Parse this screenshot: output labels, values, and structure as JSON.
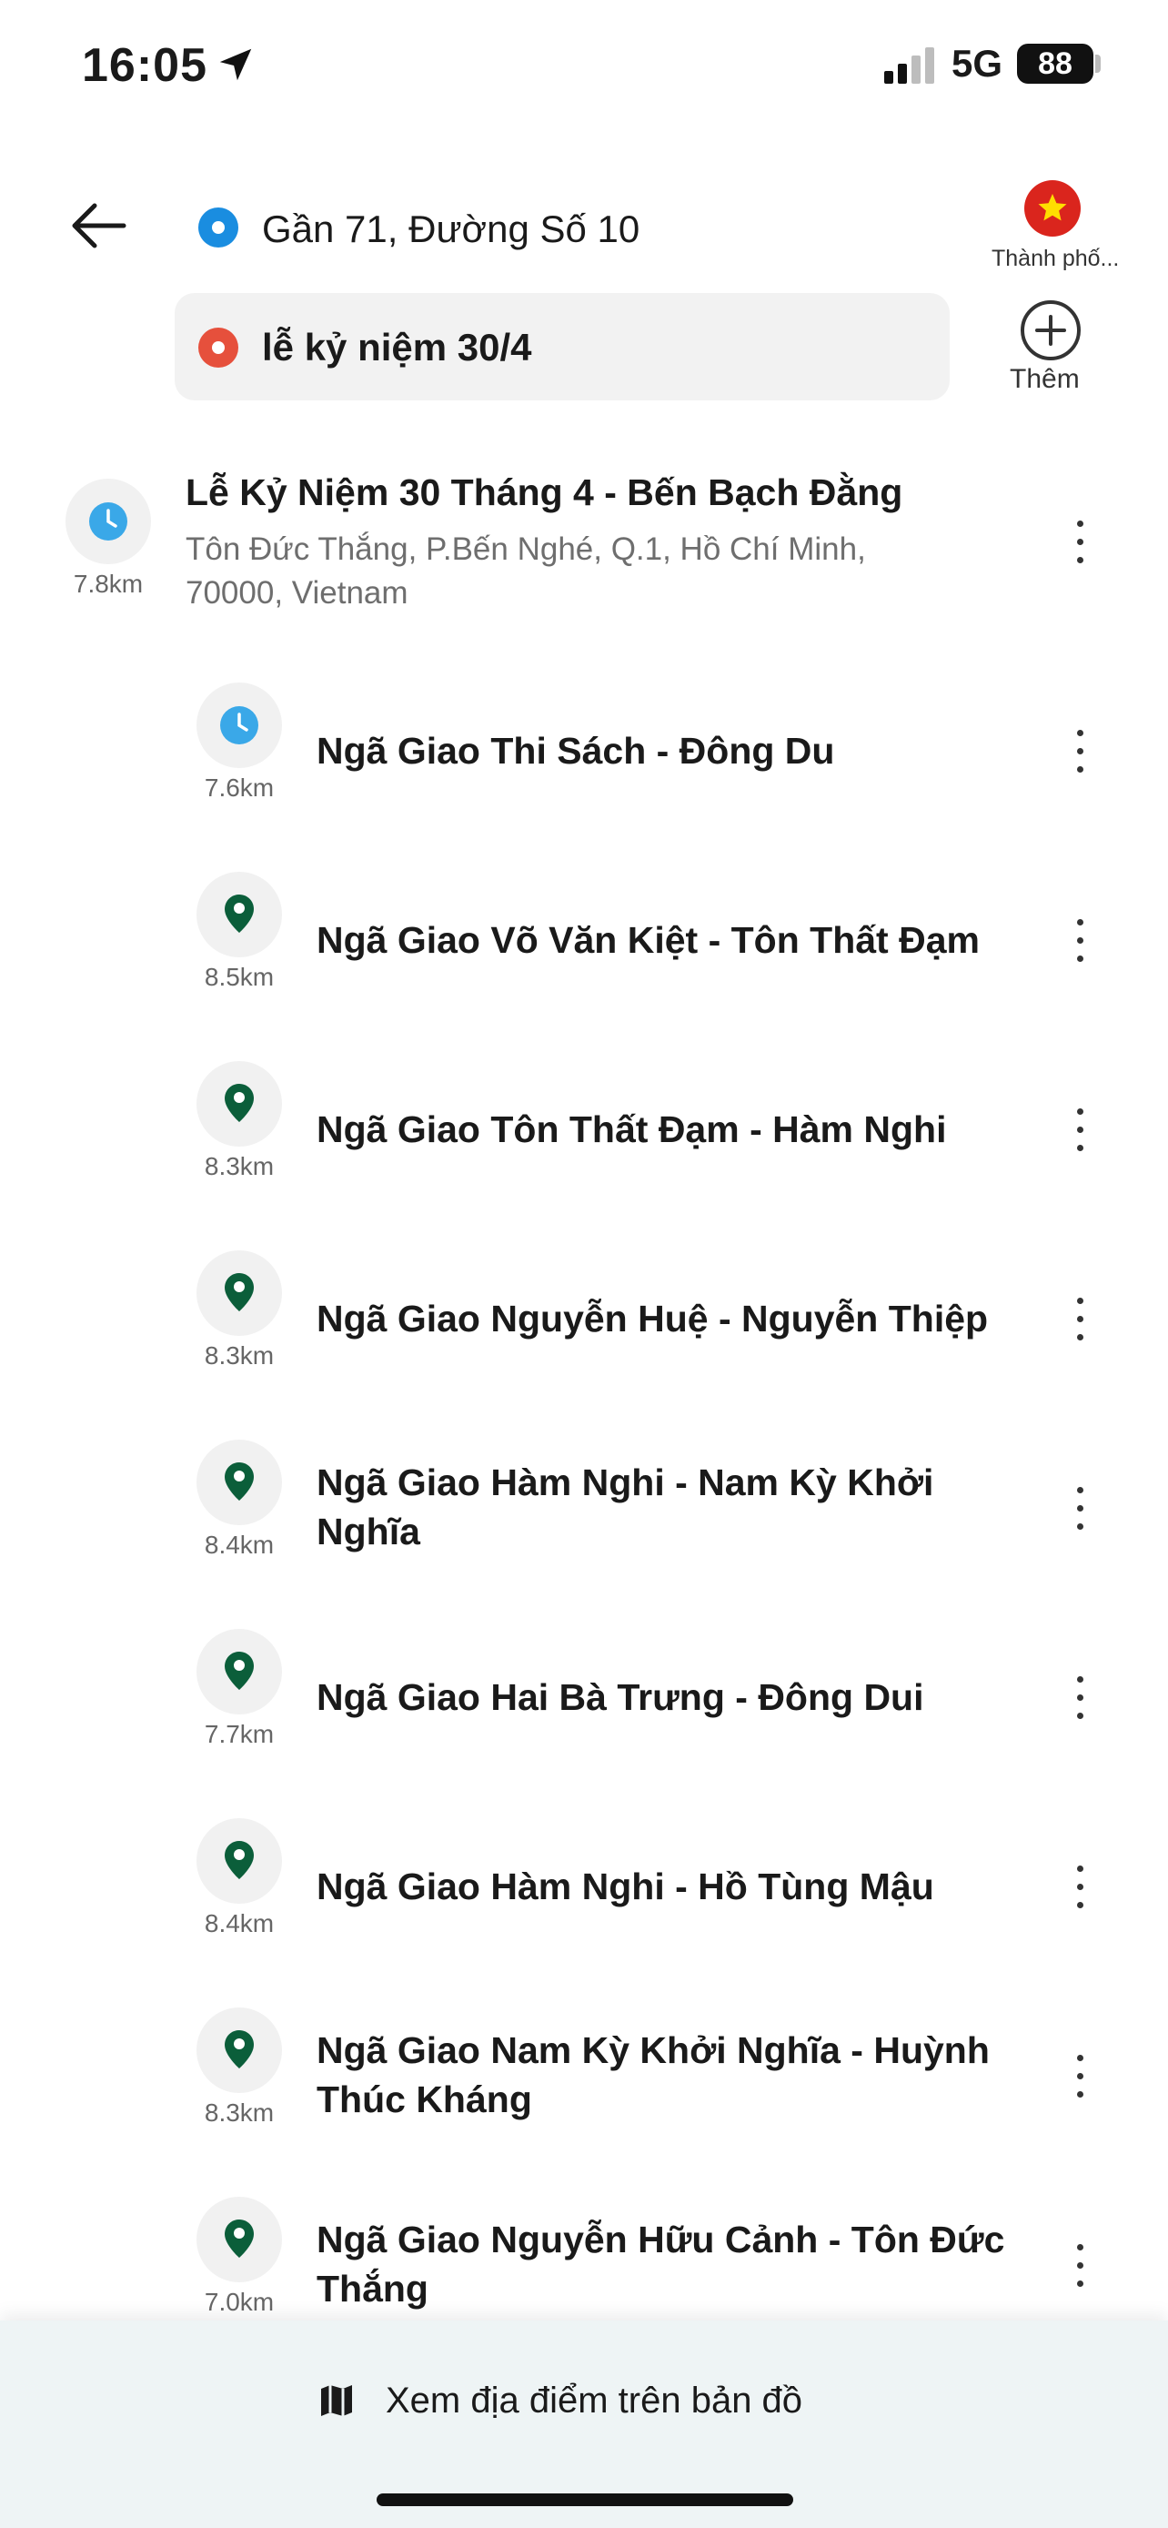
{
  "status_bar": {
    "time": "16:05",
    "network": "5G",
    "battery": "88"
  },
  "header": {
    "origin": "Gần 71, Đường Số 10",
    "destination": "lễ kỷ niệm 30/4",
    "city_label": "Thành phố...",
    "add_label": "Thêm"
  },
  "top_result": {
    "title": "Lễ Kỷ Niệm 30 Tháng 4 - Bến Bạch Đằng",
    "address_line1": "Tôn Đức Thắng, P.Bến Nghé, Q.1, Hồ Chí Minh,",
    "address_line2": "70000, Vietnam",
    "distance": "7.8km",
    "icon": "clock-icon"
  },
  "results": [
    {
      "title_line1": "Ngã Giao Thi Sách - Đông Du",
      "title_line2": "",
      "distance": "7.6km",
      "icon": "clock-icon"
    },
    {
      "title_line1": "Ngã Giao Võ Văn Kiệt - Tôn Thất Đạm",
      "title_line2": "",
      "distance": "8.5km",
      "icon": "pin-icon"
    },
    {
      "title_line1": "Ngã Giao Tôn Thất Đạm - Hàm Nghi",
      "title_line2": "",
      "distance": "8.3km",
      "icon": "pin-icon"
    },
    {
      "title_line1": "Ngã Giao Nguyễn Huệ - Nguyễn Thiệp",
      "title_line2": "",
      "distance": "8.3km",
      "icon": "pin-icon"
    },
    {
      "title_line1": "Ngã Giao Hàm Nghi - Nam Kỳ Khởi",
      "title_line2": "Nghĩa",
      "distance": "8.4km",
      "icon": "pin-icon"
    },
    {
      "title_line1": "Ngã Giao Hai Bà Trưng - Đông Dui",
      "title_line2": "",
      "distance": "7.7km",
      "icon": "pin-icon"
    },
    {
      "title_line1": "Ngã Giao Hàm Nghi - Hồ Tùng Mậu",
      "title_line2": "",
      "distance": "8.4km",
      "icon": "pin-icon"
    },
    {
      "title_line1": "Ngã Giao Nam Kỳ Khởi Nghĩa - Huỳnh",
      "title_line2": "Thúc Kháng",
      "distance": "8.3km",
      "icon": "pin-icon"
    },
    {
      "title_line1": "Ngã Giao Nguyễn Hữu Cảnh - Tôn Đức",
      "title_line2": "Thắng",
      "distance": "7.0km",
      "icon": "pin-icon"
    }
  ],
  "bottom": {
    "map_button": "Xem địa điểm trên bản đồ"
  },
  "colors": {
    "origin_dot": "#1a8de0",
    "destination_dot": "#e6503c",
    "clock_icon": "#3aa8e8",
    "pin_icon": "#0b5e3a",
    "flag_red": "#da251d",
    "flag_star": "#ffde00"
  }
}
